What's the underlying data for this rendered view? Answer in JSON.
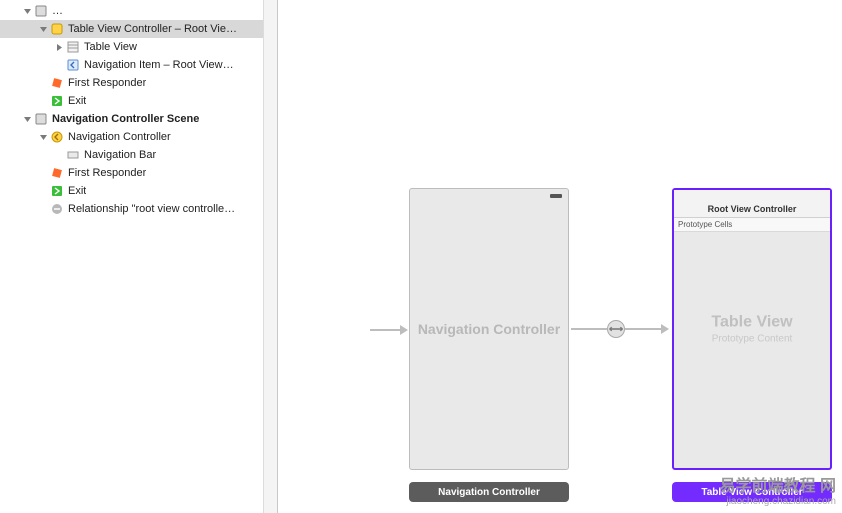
{
  "outline": {
    "scene1": {
      "header": "Table View Controller – Root Vie…",
      "controller": "Table View Controller – Root Vie…",
      "tableView": "Table View",
      "navItem": "Navigation Item – Root View…",
      "firstResponder": "First Responder",
      "exit": "Exit"
    },
    "scene2": {
      "header": "Navigation Controller Scene",
      "controller": "Navigation Controller",
      "navBar": "Navigation Bar",
      "firstResponder": "First Responder",
      "exit": "Exit",
      "relationship": "Relationship \"root view controlle…"
    }
  },
  "canvas": {
    "navScene": {
      "placeholder": "Navigation Controller",
      "label": "Navigation Controller"
    },
    "tableScene": {
      "navTitle": "Root View Controller",
      "protoCells": "Prototype Cells",
      "placeholderMain": "Table View",
      "placeholderSub": "Prototype Content",
      "label": "Table View Controller"
    },
    "segueKnob": "⟷"
  },
  "watermark": {
    "line1": "易学前端教程 网",
    "line2": "jiaocheng.chazidian.com"
  }
}
